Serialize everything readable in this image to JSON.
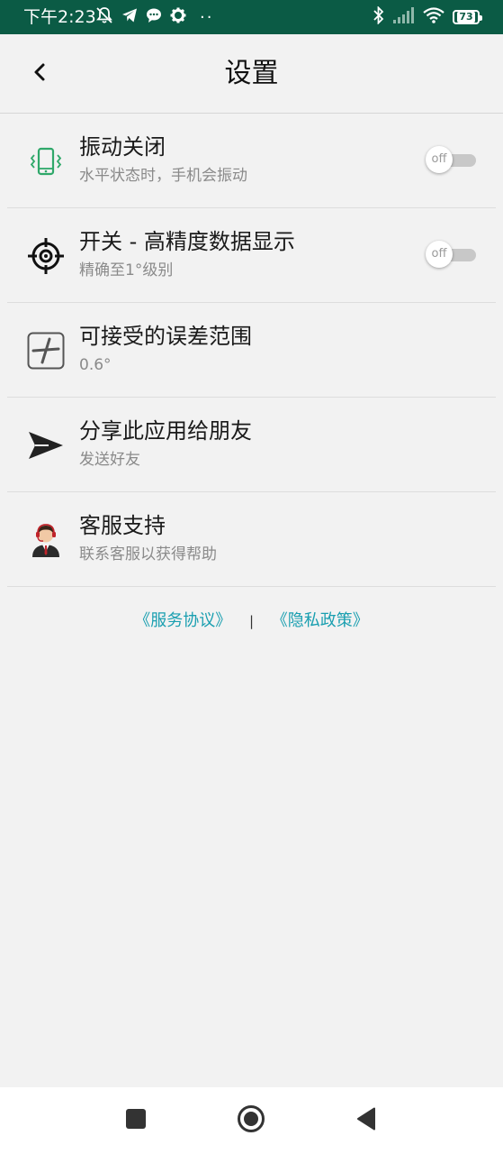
{
  "status_bar": {
    "time": "下午2:23",
    "battery": "73",
    "icons_left": [
      "mute-bell-icon",
      "telegram-icon",
      "chat-bubble-icon",
      "gear-icon"
    ],
    "icons_right": [
      "bluetooth-icon",
      "signal-icon",
      "wifi-icon",
      "battery-icon"
    ]
  },
  "header": {
    "title": "设置",
    "back_icon": "back-arrow-icon"
  },
  "settings": [
    {
      "title": "振动关闭",
      "subtitle": "水平状态时，手机会振动",
      "icon": "vibrate-phone-icon",
      "toggle": "off"
    },
    {
      "title": "开关 - 高精度数据显示",
      "subtitle": "精确至1°级别",
      "icon": "crosshair-icon",
      "toggle": "off"
    },
    {
      "title": "可接受的误差范围",
      "subtitle": "0.6°",
      "icon": "tolerance-icon"
    },
    {
      "title": "分享此应用给朋友",
      "subtitle": "发送好友",
      "icon": "send-icon"
    },
    {
      "title": "客服支持",
      "subtitle": "联系客服以获得帮助",
      "icon": "support-agent-icon"
    }
  ],
  "links": {
    "service": "《服务协议》",
    "separator": "|",
    "privacy": "《隐私政策》"
  },
  "nav_bar": {
    "icons": [
      "recent-apps-icon",
      "home-icon",
      "back-icon"
    ]
  },
  "colors": {
    "status_bar": "#0b5b45",
    "link": "#1a9fb0",
    "vibrate_icon": "#2fa86a"
  }
}
